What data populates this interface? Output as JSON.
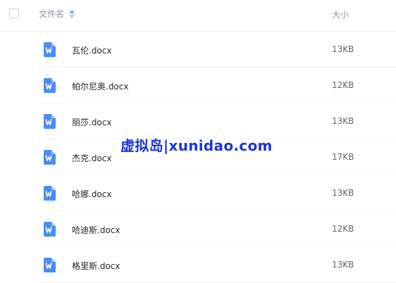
{
  "header": {
    "name_label": "文件名",
    "size_label": "大小"
  },
  "files": [
    {
      "name": "瓦伦.docx",
      "size": "13KB",
      "icon": "word-doc-icon"
    },
    {
      "name": "帕尔尼奥.docx",
      "size": "12KB",
      "icon": "word-doc-icon"
    },
    {
      "name": "丽莎.docx",
      "size": "13KB",
      "icon": "word-doc-icon"
    },
    {
      "name": "杰克.docx",
      "size": "17KB",
      "icon": "word-doc-icon"
    },
    {
      "name": "哈娜.docx",
      "size": "13KB",
      "icon": "word-doc-icon"
    },
    {
      "name": "哈迪斯.docx",
      "size": "12KB",
      "icon": "word-doc-icon"
    },
    {
      "name": "格里斯.docx",
      "size": "13KB",
      "icon": "word-doc-icon"
    }
  ],
  "watermark": "虚拟岛|xunidao.com",
  "colors": {
    "icon_blue": "#4a8ef2",
    "sort_active": "#57a9f2",
    "watermark": "#1f35d6"
  }
}
